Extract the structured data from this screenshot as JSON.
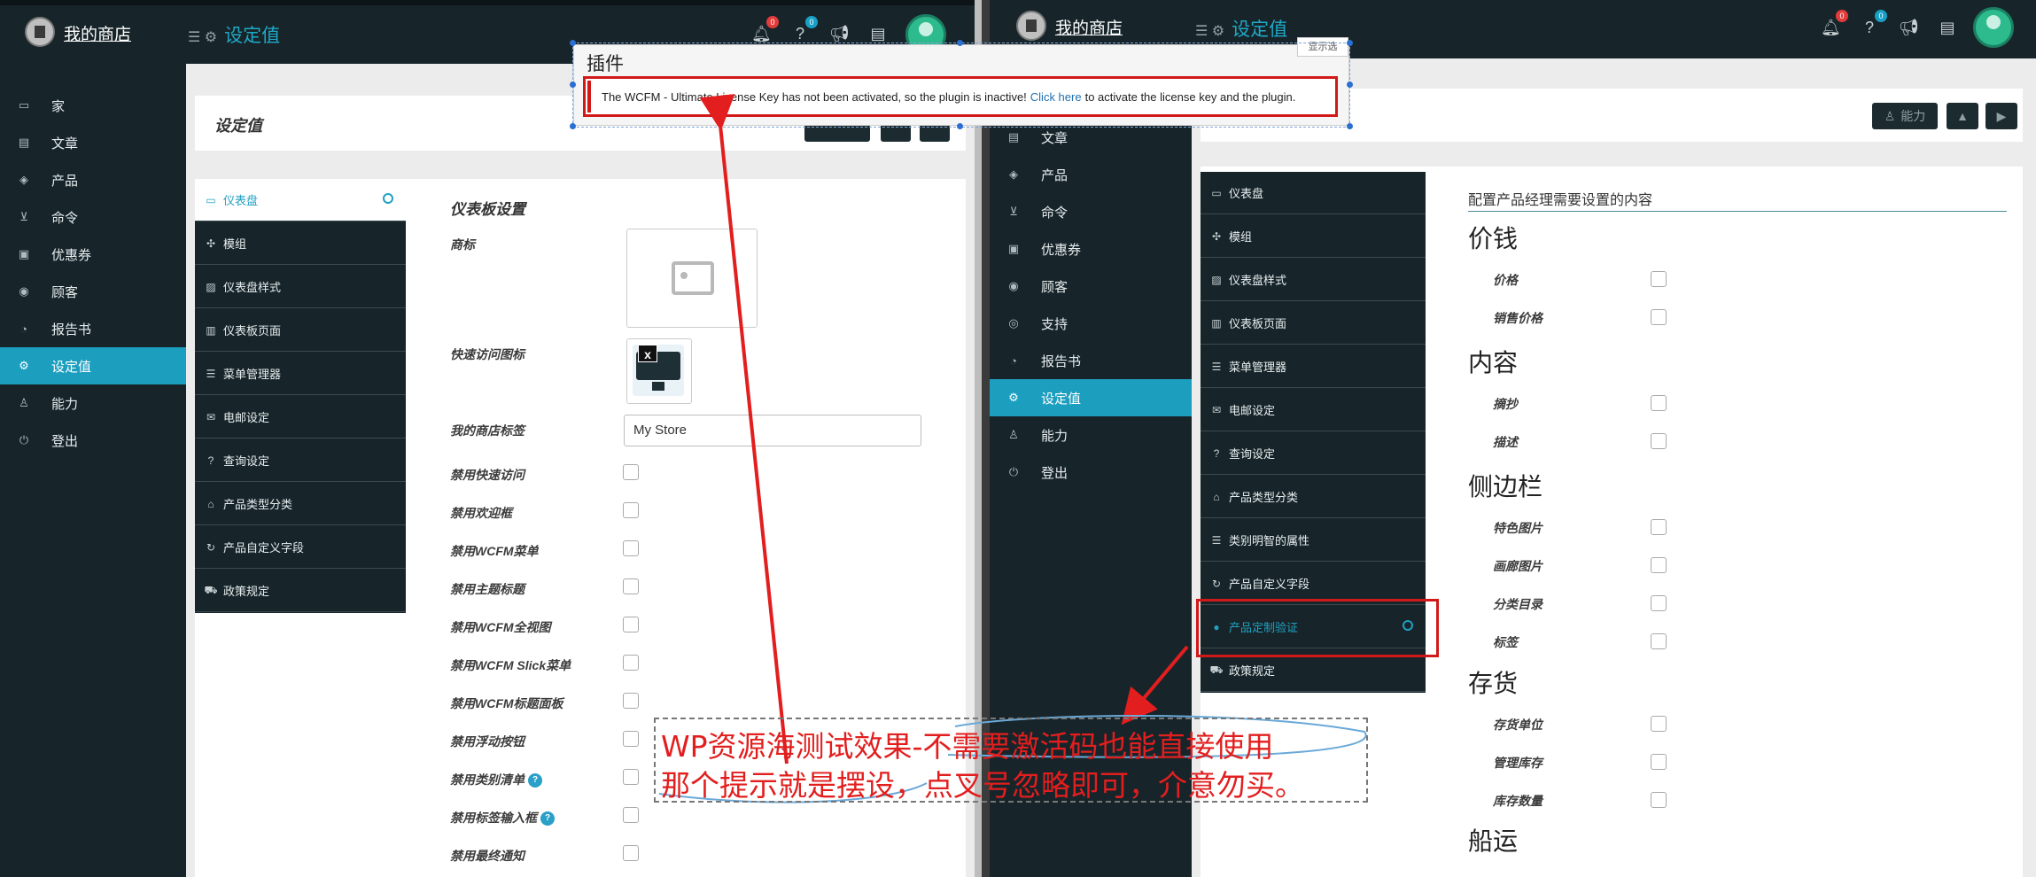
{
  "brand": {
    "name": "我的商店"
  },
  "topbar": {
    "title": "设定值",
    "notif_count": "0",
    "help_count": "0"
  },
  "left": {
    "nav": [
      "家",
      "文章",
      "产品",
      "命令",
      "优惠券",
      "顾客",
      "报告书",
      "设定值",
      "能力",
      "登出"
    ],
    "page_title": "设定值",
    "menu": [
      "仪表盘",
      "模组",
      "仪表盘样式",
      "仪表板页面",
      "菜单管理器",
      "电邮设定",
      "查询设定",
      "产品类型分类",
      "产品自定义字段",
      "政策规定"
    ],
    "section_title": "仪表板设置",
    "fields": {
      "logo": "商标",
      "quick_icon": "快速访问图标",
      "store_label": "我的商店标签",
      "store_label_value": "My Store",
      "disable_quick": "禁用快速访问",
      "disable_welcome": "禁用欢迎框",
      "disable_wcfm_menu": "禁用WCFM菜单",
      "disable_theme_header": "禁用主题标题",
      "disable_full_view": "禁用WCFM全视图",
      "disable_slick": "禁用WCFM Slick菜单",
      "disable_header_panel": "禁用WCFM标题面板",
      "disable_float_btn": "禁用浮动按钮",
      "disable_cat_list": "禁用类别清单",
      "disable_tag_input": "禁用标签输入框",
      "disable_last_notice": "禁用最终通知"
    }
  },
  "right": {
    "nav": [
      "文章",
      "产品",
      "命令",
      "优惠券",
      "顾客",
      "支持",
      "报告书",
      "设定值",
      "能力",
      "登出"
    ],
    "header_btn": "能力",
    "menu": [
      "仪表盘",
      "模组",
      "仪表盘样式",
      "仪表板页面",
      "菜单管理器",
      "电邮设定",
      "查询设定",
      "产品类型分类",
      "类别明智的属性",
      "产品自定义字段",
      "产品定制验证",
      "政策规定"
    ],
    "subtitle": "配置产品经理需要设置的内容",
    "groups": [
      {
        "title": "价钱",
        "items": [
          "价格",
          "销售价格"
        ]
      },
      {
        "title": "内容",
        "items": [
          "摘抄",
          "描述"
        ]
      },
      {
        "title": "侧边栏",
        "items": [
          "特色图片",
          "画廊图片",
          "分类目录",
          "标签"
        ]
      },
      {
        "title": "存货",
        "items": [
          "存货单位",
          "管理库存",
          "库存数量"
        ]
      },
      {
        "title": "船运",
        "items": []
      }
    ]
  },
  "plugin_notice": {
    "title": "插件",
    "show_btn": "显示选",
    "text_before": "The WCFM - Ultimate License Key has not been activated, so the plugin is inactive!",
    "link": "Click here",
    "text_after": "to activate the license key and the plugin."
  },
  "annotation": {
    "line1": "WP资源海测试效果-不需要激活码也能直接使用",
    "line2": "那个提示就是摆设，点叉号忽略即可，介意勿买。"
  },
  "colors": {
    "accent": "#1c9ebf",
    "dark": "#17252a",
    "red": "#d11919"
  }
}
